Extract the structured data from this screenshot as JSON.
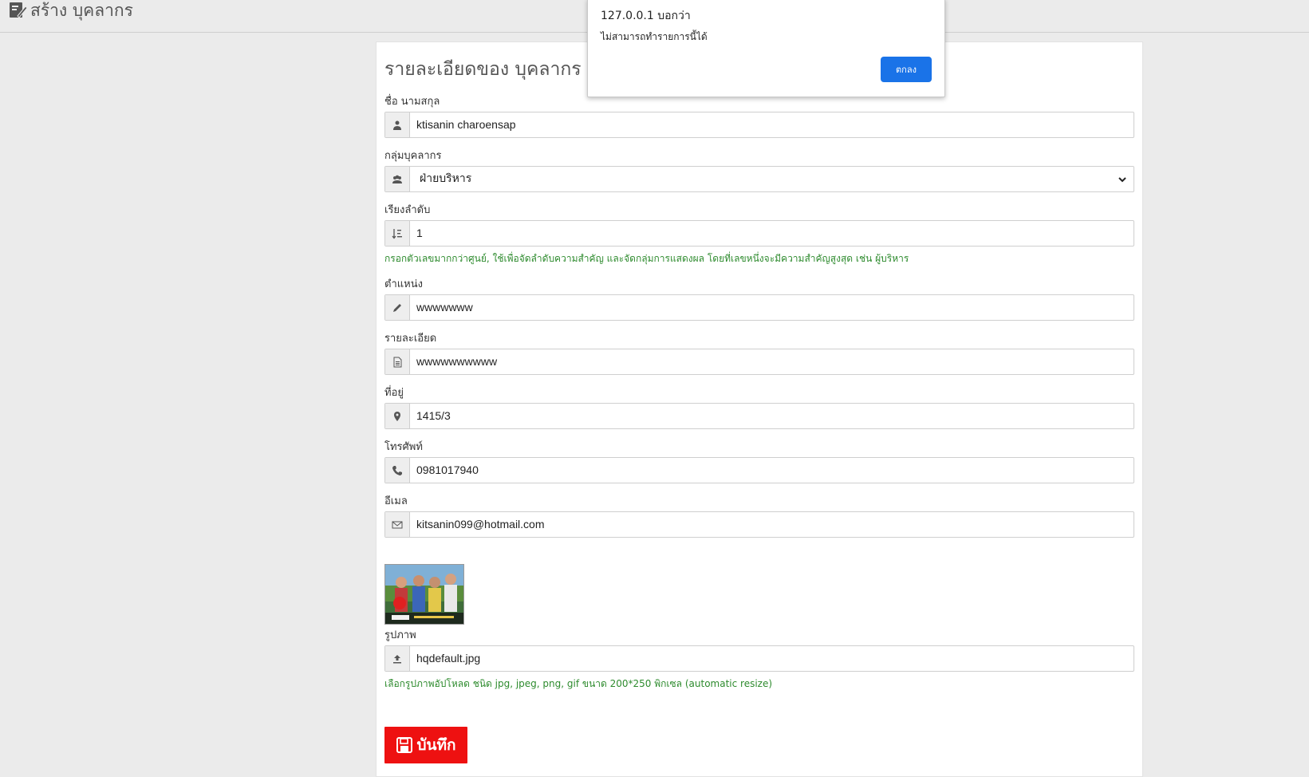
{
  "header": {
    "title": "สร้าง บุคลากร"
  },
  "form": {
    "title": "รายละเอียดของ บุคลากร",
    "fields": {
      "name": {
        "label": "ชื่อ นามสกุล",
        "value": "ktisanin charoensap"
      },
      "group": {
        "label": "กลุ่มบุคลากร",
        "value": "ฝ่ายบริหาร"
      },
      "order": {
        "label": "เรียงลำดับ",
        "value": "1",
        "help": "กรอกตัวเลขมากกว่าศูนย์, ใช้เพื่อจัดลำดับความสำคัญ และจัดกลุ่มการแสดงผล โดยที่เลขหนึ่งจะมีความสำคัญสูงสุด เช่น ผู้บริหาร"
      },
      "position": {
        "label": "ตำแหน่ง",
        "value": "wwwwwww"
      },
      "detail": {
        "label": "รายละเอียด",
        "value": "wwwwwwwwww"
      },
      "address": {
        "label": "ที่อยู่",
        "value": "1415/3"
      },
      "phone": {
        "label": "โทรศัพท์",
        "value": "0981017940"
      },
      "email": {
        "label": "อีเมล",
        "value": "kitsanin099@hotmail.com"
      },
      "image": {
        "label": "รูปภาพ",
        "value": "hqdefault.jpg",
        "help": "เลือกรูปภาพอัปโหลด ชนิด jpg, jpeg, png, gif ขนาด 200*250 พิกเซล (automatic resize)"
      }
    },
    "save_label": "บันทึก"
  },
  "dialog": {
    "title": "127.0.0.1 บอกว่า",
    "message": "ไม่สามารถทำรายการนี้ได้",
    "ok_label": "ตกลง"
  },
  "colors": {
    "save_button": "#ee1111",
    "dialog_ok": "#1a73e8",
    "help_text": "#2e8b2e"
  }
}
